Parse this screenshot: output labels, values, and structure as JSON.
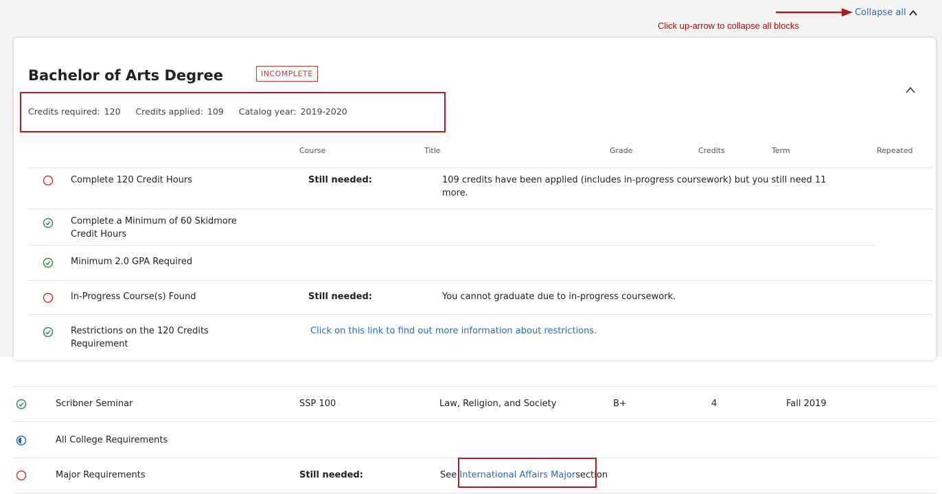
{
  "annotation": {
    "arrow_text": "Click up-arrow to collapse all blocks"
  },
  "toolbar": {
    "collapse_all_label": "Collapse all"
  },
  "degree": {
    "title": "Bachelor of Arts Degree",
    "status": "INCOMPLETE",
    "credits_required_label": "Credits required:",
    "credits_required": "120",
    "credits_applied_label": "Credits applied:",
    "credits_applied": "109",
    "catalog_year_label": "Catalog year:",
    "catalog_year": "2019-2020"
  },
  "columns": {
    "course": "Course",
    "title": "Title",
    "grade": "Grade",
    "credits": "Credits",
    "term": "Term",
    "repeated": "Repeated"
  },
  "degree_rows": [
    {
      "label": "Complete 120 Credit Hours",
      "status": "incomplete",
      "still_needed": "Still needed:",
      "detail": "109 credits have been applied (includes in-progress coursework) but you still need 11 more."
    },
    {
      "label": "Complete a Minimum of 60 Skidmore Credit Hours",
      "status": "complete"
    },
    {
      "label": "Minimum 2.0 GPA Required",
      "status": "complete"
    },
    {
      "label": "In-Progress Course(s) Found",
      "status": "incomplete",
      "still_needed": "Still needed:",
      "detail": "You cannot graduate due to in-progress coursework."
    },
    {
      "label": "Restrictions on the 120 Credits Requirement",
      "status": "complete",
      "link": "Click on this link to find out more information about restrictions."
    }
  ],
  "lower_rows": [
    {
      "label": "Scribner Seminar",
      "status": "complete",
      "course": "SSP 100",
      "title": "Law, Religion, and Society",
      "grade": "B+",
      "credits": "4",
      "term": "Fall 2019"
    },
    {
      "label": "All College Requirements",
      "status": "in-progress"
    },
    {
      "label": "Major Requirements",
      "status": "incomplete",
      "still_needed": "Still needed:",
      "see_prefix": "See",
      "major_link": "International Affairs Major",
      "see_suffix": "section"
    }
  ],
  "colors": {
    "complete": "#2e8b57",
    "incomplete": "#d9342b",
    "in_progress": "#1f6fb8",
    "link": "#1f6fb8",
    "annotation": "#c00000"
  }
}
